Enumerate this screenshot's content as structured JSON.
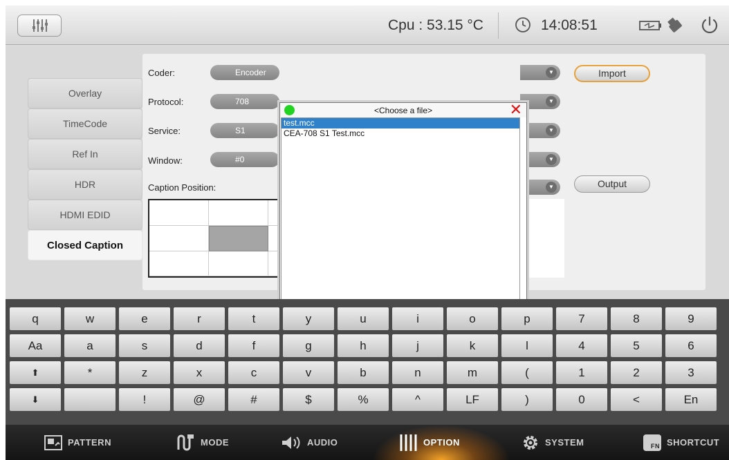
{
  "topbar": {
    "cpu_text": "Cpu : 53.15 °C",
    "time": "14:08:51",
    "icons": [
      "sliders-icon",
      "clock-icon",
      "battery-icon",
      "usb-icon",
      "power-icon"
    ]
  },
  "tabs": [
    {
      "label": "Overlay",
      "active": false
    },
    {
      "label": "TimeCode",
      "active": false
    },
    {
      "label": "Ref In",
      "active": false
    },
    {
      "label": "HDR",
      "active": false
    },
    {
      "label": "HDMI EDID",
      "active": false
    },
    {
      "label": "Closed Caption",
      "active": true
    }
  ],
  "form": {
    "coder_label": "Coder:",
    "coder_value": "Encoder",
    "protocol_label": "Protocol:",
    "protocol_value": "708",
    "service_label": "Service:",
    "service_value": "S1",
    "window_label": "Window:",
    "window_value": "#0",
    "caption_position_label": "Caption Position:",
    "import_label": "Import",
    "output_label": "Output"
  },
  "dialog": {
    "title": "<Choose a file>",
    "close": "✕",
    "files": [
      "test.mcc",
      "CEA-708 S1 Test.mcc"
    ],
    "selected_index": 0
  },
  "keyboard": {
    "rows": [
      [
        "q",
        "w",
        "e",
        "r",
        "t",
        "y",
        "u",
        "i",
        "o",
        "p",
        "7",
        "8",
        "9"
      ],
      [
        "Aa",
        "a",
        "s",
        "d",
        "f",
        "g",
        "h",
        "j",
        "k",
        "l",
        "4",
        "5",
        "6"
      ],
      [
        "⬆",
        "*",
        "z",
        "x",
        "c",
        "v",
        "b",
        "n",
        "m",
        "(",
        "1",
        "2",
        "3"
      ],
      [
        "⬇",
        "",
        "!",
        "@",
        "#",
        "$",
        "%",
        "^",
        "LF",
        ")",
        "0",
        "<",
        "En"
      ]
    ]
  },
  "bottom_nav": {
    "pattern": "PATTERN",
    "mode": "MODE",
    "audio": "AUDIO",
    "option": "OPTION",
    "system": "SYSTEM",
    "shortcut": "SHORTCUT",
    "fn_badge": "FN",
    "active": "OPTION"
  },
  "colors": {
    "accent_orange": "#e8a13a",
    "selection_blue": "#2f82c9",
    "close_red": "#e01010",
    "status_green": "#22d322"
  }
}
